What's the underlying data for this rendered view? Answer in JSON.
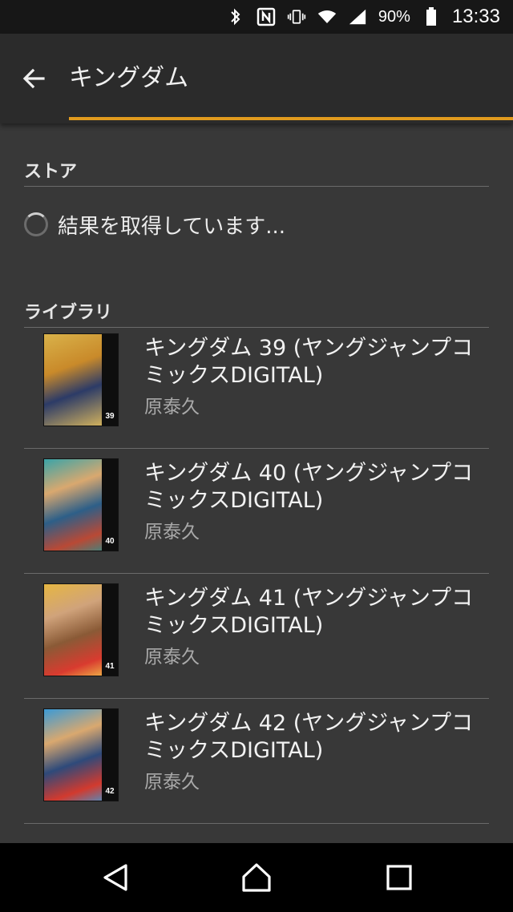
{
  "status_bar": {
    "icons": [
      "bluetooth-icon",
      "nfc-icon",
      "vibrate-icon",
      "wifi-icon",
      "signal-icon",
      "battery-icon"
    ],
    "battery": "90%",
    "time": "13:33"
  },
  "app_bar": {
    "title": "キングダム",
    "accent_color": "#e19b1e"
  },
  "sections": {
    "store": {
      "header": "ストア",
      "loading_text": "結果を取得しています..."
    },
    "library": {
      "header": "ライブラリ",
      "items": [
        {
          "title": "キングダム 39 (ヤングジャンプコミックスDIGITAL)",
          "author": "原泰久",
          "volume": "39"
        },
        {
          "title": "キングダム 40 (ヤングジャンプコミックスDIGITAL)",
          "author": "原泰久",
          "volume": "40"
        },
        {
          "title": "キングダム 41 (ヤングジャンプコミックスDIGITAL)",
          "author": "原泰久",
          "volume": "41"
        },
        {
          "title": "キングダム 42 (ヤングジャンプコミックスDIGITAL)",
          "author": "原泰久",
          "volume": "42"
        }
      ]
    }
  },
  "nav_bar": {
    "buttons": [
      "back-nav-icon",
      "home-nav-icon",
      "recents-nav-icon"
    ]
  }
}
